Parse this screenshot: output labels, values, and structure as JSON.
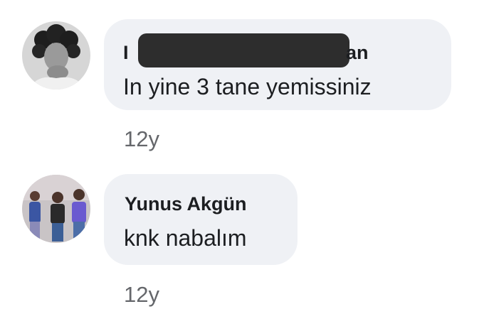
{
  "comments": [
    {
      "author_visible_prefix": "I",
      "author_visible_suffix": "an",
      "author_redacted": true,
      "text": "In yine 3 tane yemissiniz",
      "time": "12y"
    },
    {
      "author": "Yunus Akgün",
      "text": "knk nabalım",
      "time": "12y"
    }
  ]
}
